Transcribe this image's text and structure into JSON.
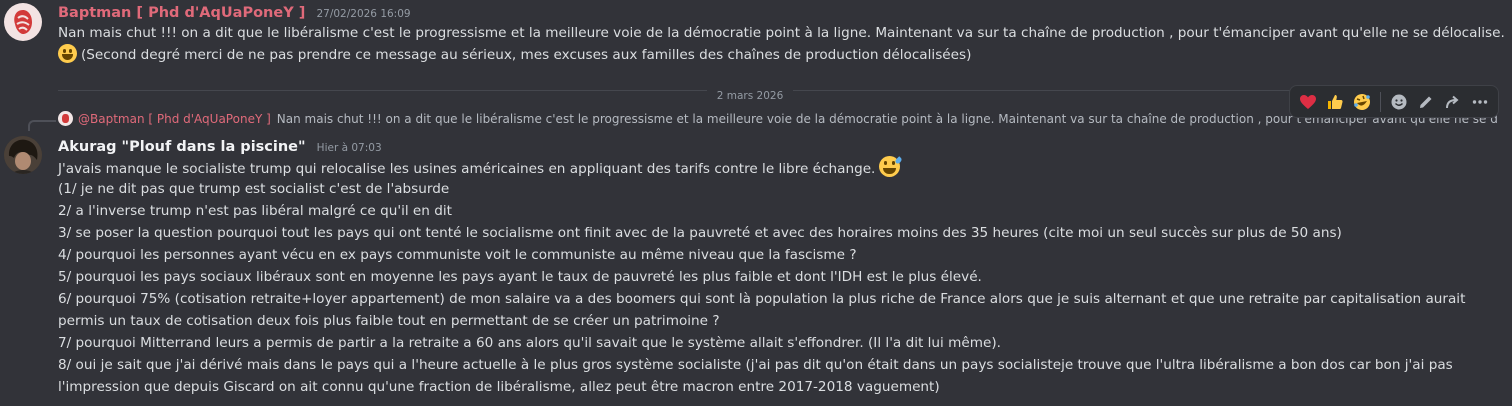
{
  "message1": {
    "author": "Baptman [ Phd d'AqUaPoneY ]",
    "timestamp": "27/02/2026 16:09",
    "line1": "Nan mais chut !!! on a dit que le libéralisme c'est le progressisme et la meilleure voie de la démocratie point à la ligne. Maintenant va sur ta chaîne de production , pour t'émanciper avant qu'elle ne se délocalise.",
    "line2": "(Second degré merci de ne pas prendre ce message au sérieux, mes excuses aux familles des chaînes de production délocalisées)",
    "author_color": "#e06a7a"
  },
  "date_divider": "2 mars 2026",
  "reply_preview": {
    "author": "@Baptman [ Phd d'AqUaPoneY ]",
    "text": "Nan mais chut !!! on a dit que le libéralisme c'est le progressisme et la meilleure voie de la démocratie point à la ligne. Maintenant va sur ta chaîne de production , pour t'émanciper avant qu'elle ne se déloca..."
  },
  "toolbar": {
    "reactions": [
      "heart",
      "thumbs-up",
      "rolling-laughing"
    ],
    "actions": [
      "add-reaction-icon",
      "edit-icon",
      "reply-icon",
      "more-icon"
    ],
    "glyphs": {
      "heart": "❤",
      "thumbs_up": "👍",
      "laugh": "🤣",
      "add_reaction": "☺",
      "edit": "✎",
      "reply": "↪",
      "more": "⋯"
    }
  },
  "message2": {
    "author": "Akurag \"Plouf dans la piscine\"",
    "timestamp": "Hier à 07:03",
    "author_color": "#f2f3f5",
    "lines": [
      "J'avais manque le socialiste trump qui relocalise les usines américaines en appliquant des tarifs contre le libre échange.",
      "(1/ je ne dit pas que trump est socialist c'est de l'absurde",
      "2/ a l'inverse trump n'est pas libéral malgré ce qu'il en dit",
      "3/ se poser la question pourquoi tout les pays qui ont tenté le socialisme ont finit avec de la pauvreté et avec des horaires moins des 35 heures (cite moi un seul succès sur plus de 50 ans)",
      "4/ pourquoi les personnes ayant vécu en ex pays communiste voit le communiste au même niveau que la fascisme ?",
      "5/ pourquoi les pays sociaux  libéraux sont en moyenne les pays ayant le taux de pauvreté les plus faible et dont l'IDH est le plus élevé.",
      "6/ pourquoi  75% (cotisation retraite+loyer appartement)  de mon salaire va a des boomers qui sont là population la plus riche de France alors que je suis alternant et que une retraite par capitalisation aurait",
      "permis un taux de cotisation deux fois plus faible tout en permettant de se créer un patrimoine ?",
      "7/ pourquoi Mitterrand leurs a permis de partir a la retraite a 60 ans alors qu'il savait que le système allait s'effondrer. (Il l'a dit lui même).",
      "8/ oui je sait que j'ai dérivé mais dans le pays qui a l'heure actuelle à le plus gros système socialiste (j'ai pas dit qu'on était dans un pays socialisteje trouve que l'ultra libéralisme a bon dos car bon j'ai pas",
      "l'impression que depuis Giscard on ait connu qu'une fraction de libéralisme, allez peut être macron entre 2017-2018 vaguement)"
    ]
  }
}
